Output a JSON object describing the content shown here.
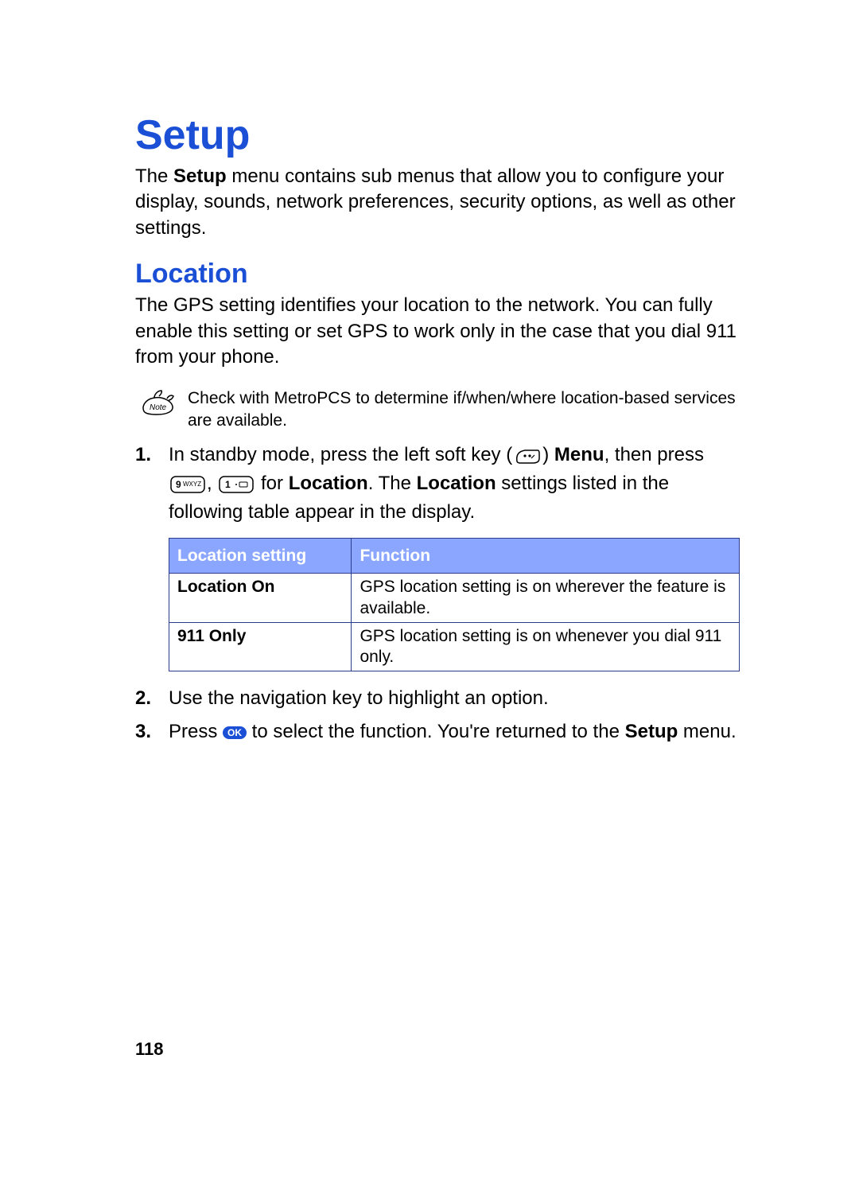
{
  "title": "Setup",
  "intro_pre": "The ",
  "intro_bold": "Setup",
  "intro_post": " menu contains sub menus that allow you to configure your display, sounds, network preferences, security options, as well as other settings.",
  "section": "Location",
  "section_intro": "The GPS setting identifies your location to the network. You can fully enable this setting or set GPS to work only in the case that you dial 911 from your phone.",
  "note": "Check with MetroPCS to determine if/when/where location-based services are available.",
  "step1": {
    "num": "1.",
    "t1": "In standby mode, press the left soft key (",
    "t2": ") ",
    "menu": "Menu",
    "t3": ", then press ",
    "comma": ", ",
    "t4": " for ",
    "loc1": "Location",
    "t5": ". The ",
    "loc2": "Location",
    "t6": " settings listed in the following table appear in the display."
  },
  "table": {
    "h1": "Location setting",
    "h2": "Function",
    "r1c1": "Location On",
    "r1c2": "GPS location setting is on wherever the feature is available.",
    "r2c1": "911 Only",
    "r2c2": "GPS location setting is on whenever you dial 911 only."
  },
  "step2": {
    "num": "2.",
    "text": "Use the navigation key to highlight an option."
  },
  "step3": {
    "num": "3.",
    "t1": "Press ",
    "ok": "OK",
    "t2": " to select the function. You're returned to the ",
    "setup": "Setup",
    "t3": " menu."
  },
  "page_number": "118"
}
